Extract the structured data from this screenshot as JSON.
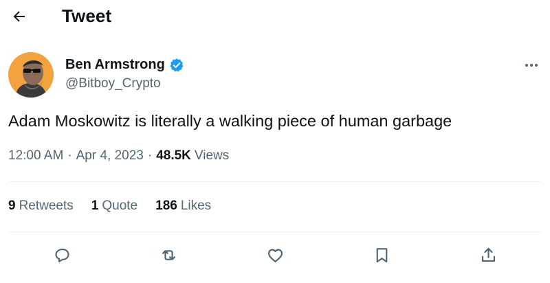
{
  "header": {
    "title": "Tweet",
    "back_icon": "arrow-left-icon"
  },
  "author": {
    "display_name": "Ben Armstrong",
    "handle": "@Bitboy_Crypto",
    "verified_icon": "verified-badge-icon",
    "verified_color": "#1d9bf0",
    "avatar_bg": "#f2a340"
  },
  "more_icon": "more-horizontal-icon",
  "tweet": {
    "text": "Adam Moskowitz is literally a walking piece of human garbage",
    "time": "12:00 AM",
    "separator": "·",
    "date": "Apr 4, 2023",
    "views_count": "48.5K",
    "views_label": "Views"
  },
  "stats": {
    "retweets": {
      "count": "9",
      "label": "Retweets"
    },
    "quotes": {
      "count": "1",
      "label": "Quote"
    },
    "likes": {
      "count": "186",
      "label": "Likes"
    }
  },
  "actions": [
    {
      "icon": "reply-icon"
    },
    {
      "icon": "retweet-icon"
    },
    {
      "icon": "like-icon"
    },
    {
      "icon": "bookmark-icon"
    },
    {
      "icon": "share-icon"
    }
  ],
  "colors": {
    "text": "#0f1419",
    "secondary": "#536471",
    "divider": "#eff3f4"
  }
}
